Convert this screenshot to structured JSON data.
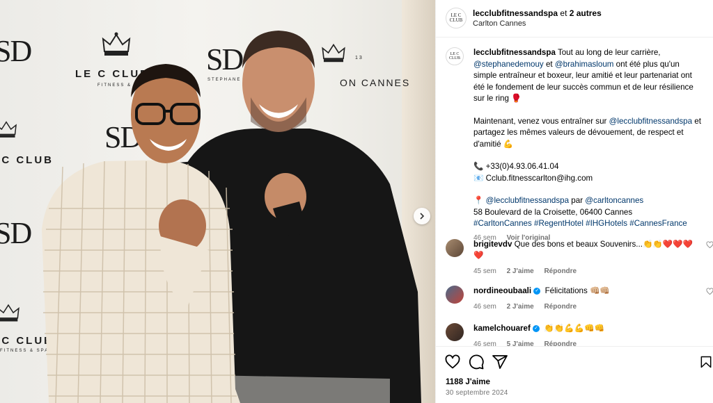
{
  "photo": {
    "backdrop": {
      "sd": "SD",
      "club_name": "LE C CLUB",
      "club_sub": "FITNESS & SPA",
      "cannes": "ON CANNES",
      "signature": "STEPHANE DEMOUY",
      "number": "13"
    }
  },
  "header": {
    "username": "lecclubfitnessandspa",
    "and_others": "et",
    "others_count": "2 autres",
    "location": "Carlton Cannes",
    "avatar_text": "LE C CLUB"
  },
  "caption": {
    "username": "lecclubfitnessandspa",
    "p1_a": "Tout au long de leur carrière, ",
    "mention1": "@stephanedemouy",
    "p1_b": " et ",
    "mention2": "@brahimasloum",
    "p1_c": " ont été plus qu'un simple entraîneur et boxeur, leur amitié et leur partenariat ont été le fondement de leur succès commun et de leur résilience sur le ring 🥊",
    "p2_a": "Maintenant, venez vous entraîner sur ",
    "mention3": "@lecclubfitnessandspa",
    "p2_b": " et partagez les mêmes valeurs de dévouement, de respect et d'amitié 💪",
    "phone": "📞 +33(0)4.93.06.41.04",
    "email": "📧 Cclub.fitnesscarlton@ihg.com",
    "loc_pin": "📍 ",
    "mention4": "@lecclubfitnessandspa",
    "par": " par ",
    "mention5": "@carltoncannes",
    "address": "58 Boulevard de la Croisette, 06400 Cannes",
    "hashtags": "#CarltonCannes #RegentHotel #IHGHotels #CannesFrance",
    "time": "46 sem",
    "see_translation": "Voir l'original"
  },
  "comments": [
    {
      "username": "brigitevdv",
      "text": "Que des bons et beaux Souvenirs...👏👏❤️❤️❤️❤️",
      "time": "45 sem",
      "likes": "2 J'aime",
      "reply": "Répondre"
    },
    {
      "username": "nordineoubaali",
      "verified": "✓",
      "text": "Félicitations 👊🏼👊🏼",
      "time": "46 sem",
      "likes": "2 J'aime",
      "reply": "Répondre"
    },
    {
      "username": "kamelchouaref",
      "verified": "✓",
      "text": "👏👏💪💪👊👊",
      "time": "46 sem",
      "likes": "5 J'aime",
      "reply": "Répondre"
    }
  ],
  "actions": {
    "like_count": "1188 J'aime",
    "date": "30 septembre 2024"
  },
  "icons": {
    "heart": "heart-icon",
    "comment": "comment-icon",
    "share": "share-icon",
    "save": "bookmark-icon",
    "next": "chevron-right-icon"
  },
  "colors": {
    "mention": "#00376b",
    "verified": "#0095f6",
    "muted": "#737373"
  }
}
